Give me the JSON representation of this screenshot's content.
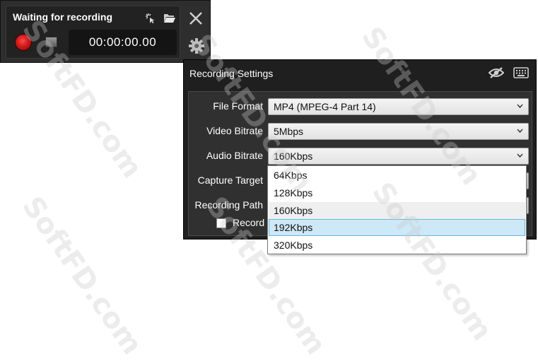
{
  "recorder": {
    "title": "Waiting for recording",
    "timer": "00:00:00.00"
  },
  "settings": {
    "title": "Recording Settings",
    "rows": [
      {
        "label": "File Format",
        "value": "MP4 (MPEG-4 Part 14)"
      },
      {
        "label": "Video Bitrate",
        "value": "5Mbps"
      },
      {
        "label": "Audio Bitrate",
        "value": "160Kbps"
      },
      {
        "label": "Capture Target",
        "value": ""
      },
      {
        "label": "Recording Path",
        "value": ""
      }
    ],
    "record_checkbox_label": "Record",
    "record_checked": false
  },
  "audio_bitrate_dropdown": {
    "options": [
      "64Kbps",
      "128Kbps",
      "160Kbps",
      "192Kbps",
      "320Kbps"
    ],
    "current": "160Kbps",
    "highlighted": "192Kbps"
  },
  "watermark": "SoftFD.com",
  "colors": {
    "record_red": "#d01a1a",
    "selection_blue": "#cde8f6",
    "panel_dark": "#1f1f1f"
  }
}
